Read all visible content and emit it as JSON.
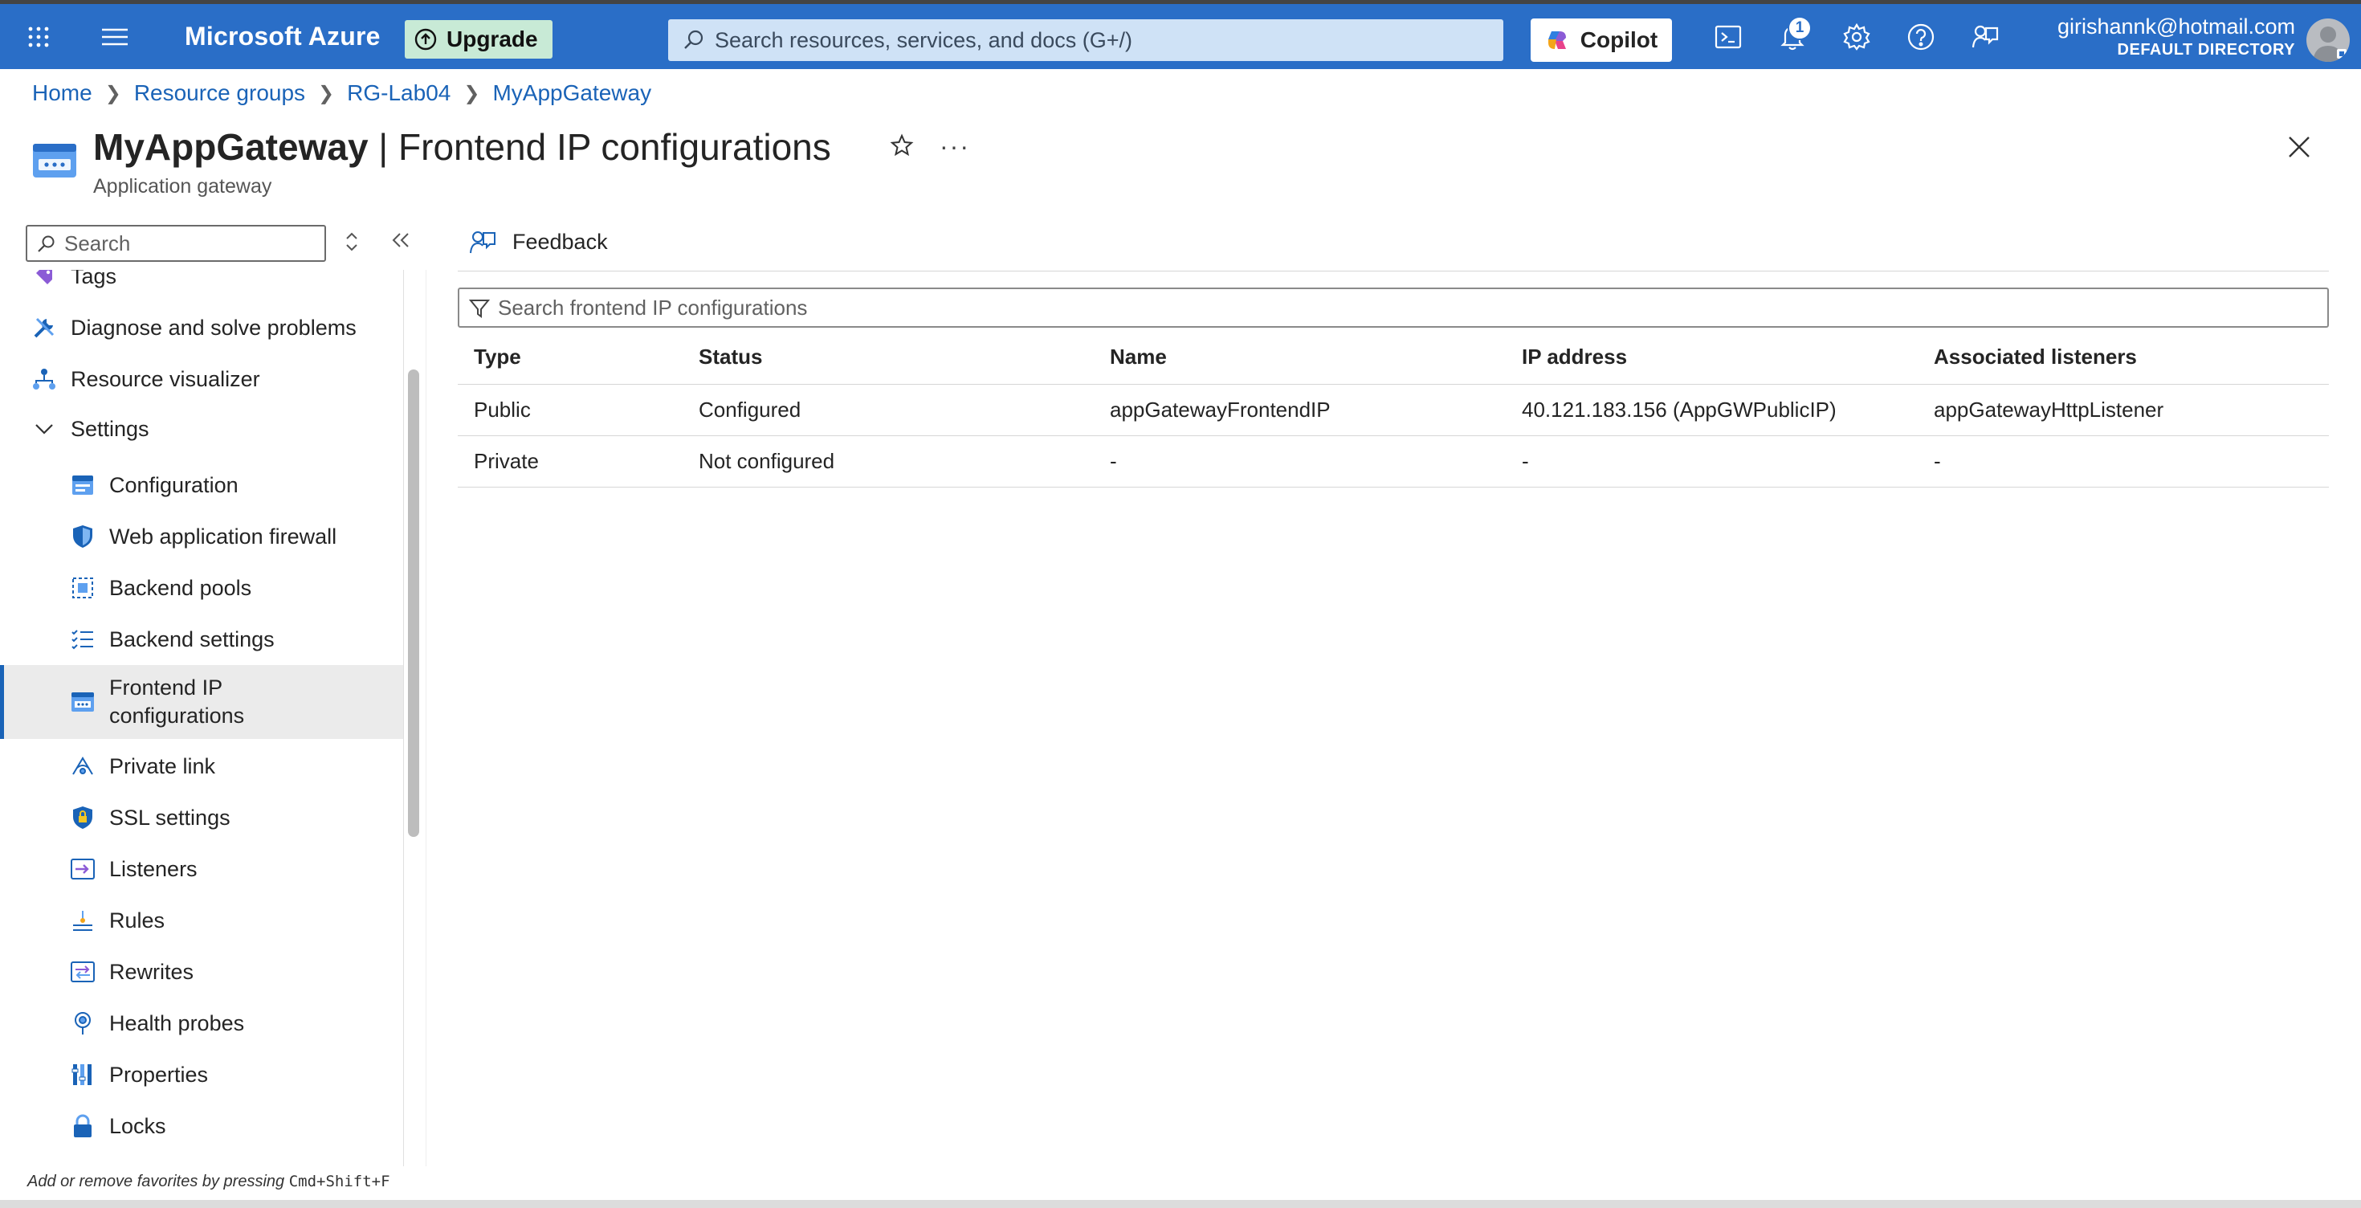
{
  "topbar": {
    "brand": "Microsoft Azure",
    "upgrade_label": "Upgrade",
    "search_placeholder": "Search resources, services, and docs (G+/)",
    "copilot_label": "Copilot",
    "notification_count": "1",
    "user_email": "girishannk@hotmail.com",
    "user_directory": "DEFAULT DIRECTORY",
    "icons": [
      "waffle-icon",
      "hamburger-icon",
      "cloud-shell-icon",
      "bell-icon",
      "gear-icon",
      "help-icon",
      "feedback-icon"
    ]
  },
  "breadcrumb": [
    "Home",
    "Resource groups",
    "RG-Lab04",
    "MyAppGateway"
  ],
  "header": {
    "resource_name": "MyAppGateway",
    "separator": " | ",
    "page_name": "Frontend IP configurations",
    "resource_type": "Application gateway"
  },
  "sidebar": {
    "search_placeholder": "Search",
    "items": [
      {
        "label": "Tags",
        "icon": "tag-icon"
      },
      {
        "label": "Diagnose and solve problems",
        "icon": "wrench-icon"
      },
      {
        "label": "Resource visualizer",
        "icon": "visualizer-icon"
      },
      {
        "label": "Settings",
        "icon": "chevron-down-icon"
      },
      {
        "label": "Configuration",
        "icon": "configuration-icon"
      },
      {
        "label": "Web application firewall",
        "icon": "shield-icon"
      },
      {
        "label": "Backend pools",
        "icon": "backend-pools-icon"
      },
      {
        "label": "Backend settings",
        "icon": "list-icon"
      },
      {
        "label": "Frontend IP configurations",
        "icon": "frontend-ip-icon"
      },
      {
        "label": "Private link",
        "icon": "private-link-icon"
      },
      {
        "label": "SSL settings",
        "icon": "ssl-shield-icon"
      },
      {
        "label": "Listeners",
        "icon": "listeners-icon"
      },
      {
        "label": "Rules",
        "icon": "rules-icon"
      },
      {
        "label": "Rewrites",
        "icon": "rewrites-icon"
      },
      {
        "label": "Health probes",
        "icon": "health-probe-icon"
      },
      {
        "label": "Properties",
        "icon": "properties-icon"
      },
      {
        "label": "Locks",
        "icon": "lock-icon"
      }
    ],
    "selected": "Frontend IP configurations",
    "favorites_hint_prefix": "Add or remove favorites by pressing ",
    "favorites_hint_keys": "Cmd+Shift+F"
  },
  "main": {
    "feedback_label": "Feedback",
    "filter_placeholder": "Search frontend IP configurations",
    "columns": [
      "Type",
      "Status",
      "Name",
      "IP address",
      "Associated listeners"
    ],
    "rows": [
      [
        "Public",
        "Configured",
        "appGatewayFrontendIP",
        "40.121.183.156 (AppGWPublicIP)",
        "appGatewayHttpListener"
      ],
      [
        "Private",
        "Not configured",
        "-",
        "-",
        "-"
      ]
    ]
  },
  "colors": {
    "topbar": "#2a6ec7",
    "link": "#1a63b7",
    "upgrade_bg": "#c8ead6",
    "selected_bg": "#ebebeb"
  }
}
